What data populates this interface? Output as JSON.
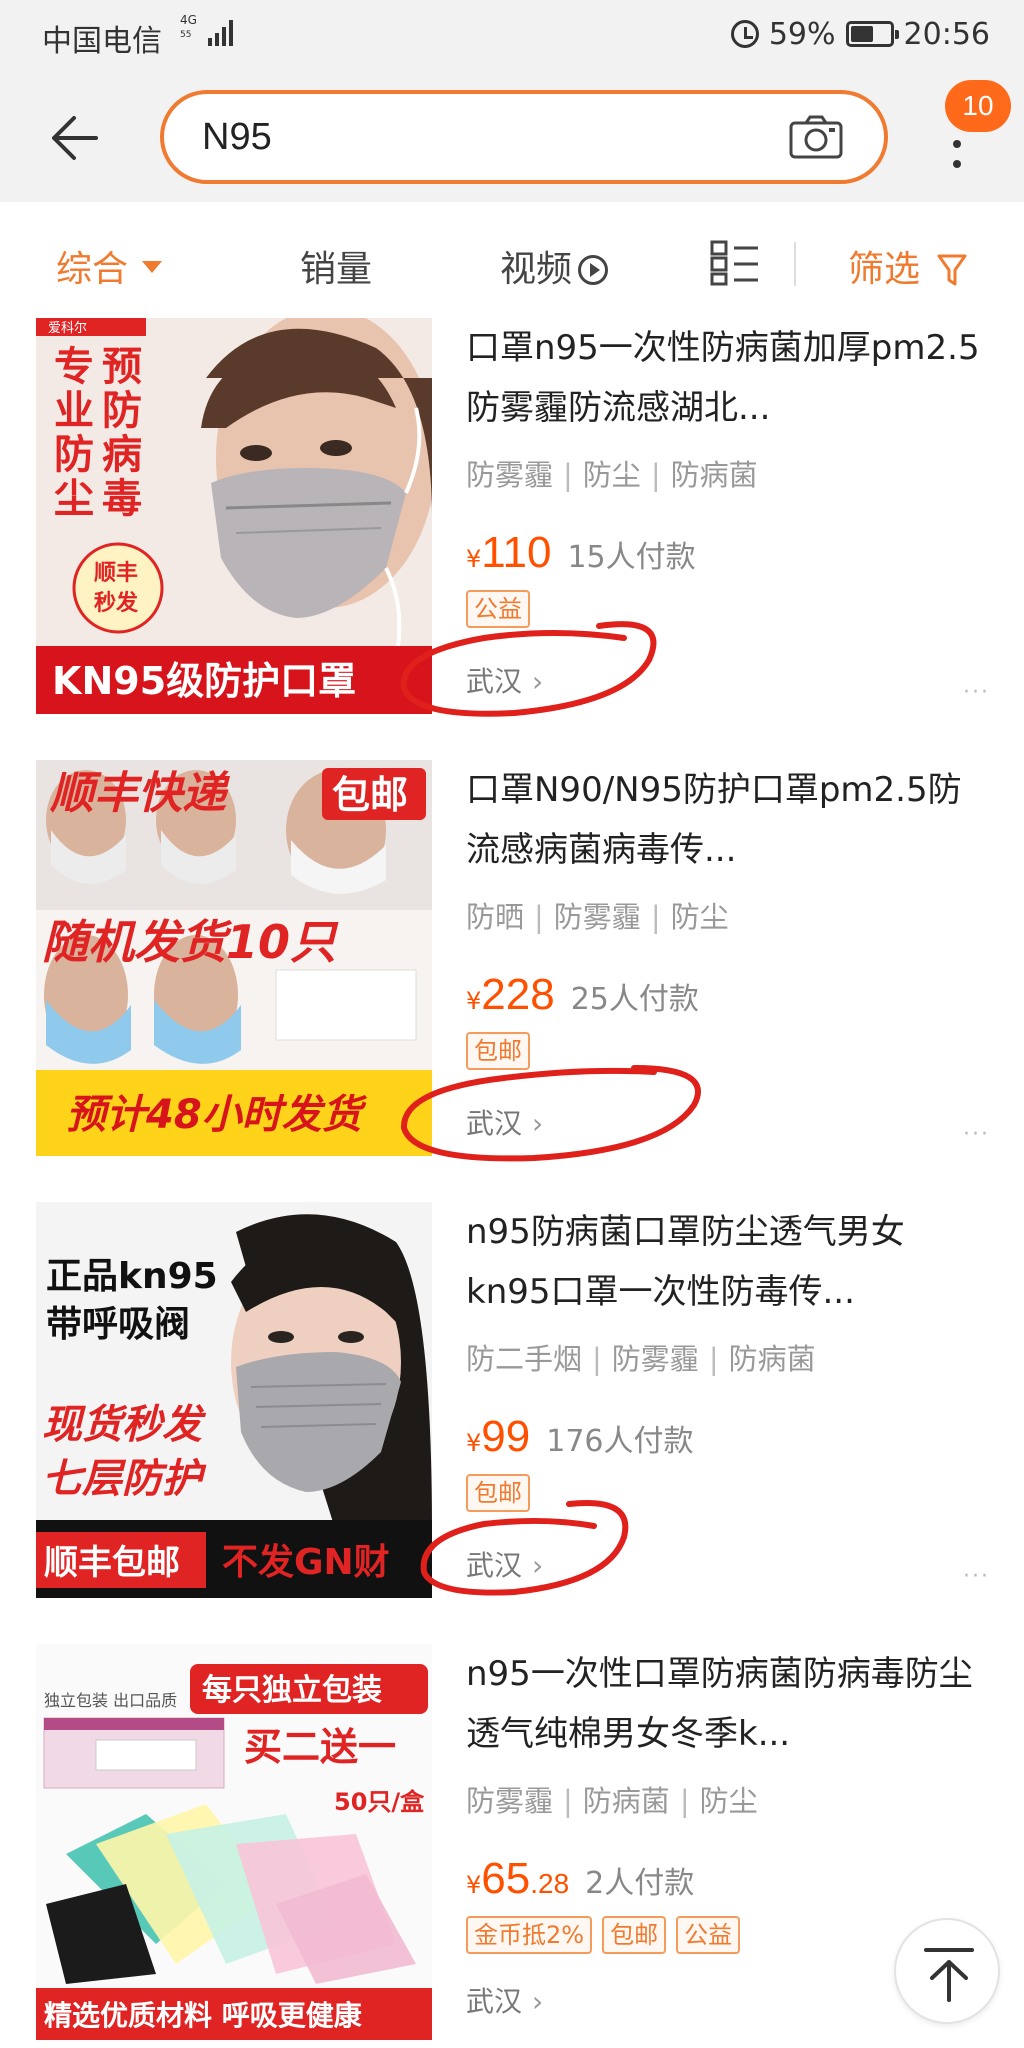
{
  "status_bar": {
    "carrier": "中国电信",
    "network": "4G",
    "signal_sub": "55",
    "battery": "59%",
    "battery_level": 0.59,
    "time": "20:56"
  },
  "header": {
    "search_query": "N95",
    "cart_badge": "10"
  },
  "filters": {
    "comprehensive": "综合",
    "sales": "销量",
    "video": "视频",
    "filter": "筛选"
  },
  "colors": {
    "accent": "#f07a2f",
    "price": "#ff5000",
    "annotation_circle": "#e0201b"
  },
  "products": [
    {
      "thumb_banner": "KN95级防护口罩",
      "thumb_side_text": [
        "专业防尘",
        "预防病毒"
      ],
      "thumb_badge": [
        "顺丰",
        "秒发"
      ],
      "thumb_top_tag": "爱科尔",
      "title": "口罩n95一次性防病菌加厚pm2.5防雾霾防流感湖北...",
      "tags": [
        "防雾霾",
        "防尘",
        "防病菌"
      ],
      "price_int": "110",
      "price_dec": "",
      "sold": "15人付款",
      "chips": [
        "公益"
      ],
      "location": "武汉"
    },
    {
      "thumb_top_left": "顺丰快递",
      "thumb_top_right": "包邮",
      "thumb_mid": "随机发货10只",
      "thumb_bottom": "预计48小时发货",
      "title": "口罩N90/N95防护口罩pm2.5防流感病菌病毒传...",
      "tags": [
        "防晒",
        "防雾霾",
        "防尘"
      ],
      "price_int": "228",
      "price_dec": "",
      "sold": "25人付款",
      "chips": [
        "包邮"
      ],
      "location": "武汉"
    },
    {
      "thumb_top": [
        "正品kn95",
        "带呼吸阀"
      ],
      "thumb_mid": [
        "现货秒发",
        "七层防护"
      ],
      "thumb_bottom_left": "顺丰包邮",
      "thumb_bottom_right": "不发GN财",
      "title": "n95防病菌口罩防尘透气男女kn95口罩一次性防毒传...",
      "tags": [
        "防二手烟",
        "防雾霾",
        "防病菌"
      ],
      "price_int": "99",
      "price_dec": "",
      "sold": "176人付款",
      "chips": [
        "包邮"
      ],
      "location": "武汉"
    },
    {
      "thumb_top_left": "独立包装 出口品质",
      "thumb_top_right": "每只独立包装",
      "thumb_promo": "买二送一",
      "thumb_count": "50只/盒",
      "thumb_bottom": "精选优质材料 呼吸更健康",
      "title": "n95一次性口罩防病菌防病毒防尘透气纯棉男女冬季k...",
      "tags": [
        "防雾霾",
        "防病菌",
        "防尘"
      ],
      "price_int": "65",
      "price_dec": ".28",
      "sold": "2人付款",
      "chips": [
        "金币抵2%",
        "包邮",
        "公益"
      ],
      "location": "武汉"
    }
  ],
  "currency_symbol": "¥",
  "more_dots": "···",
  "location_arrow": "›"
}
